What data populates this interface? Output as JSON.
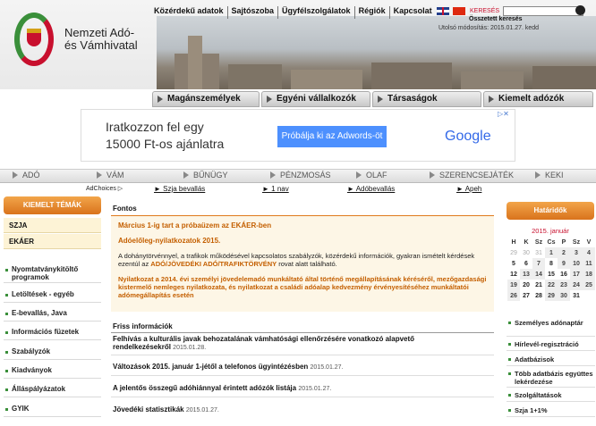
{
  "header": {
    "org_line1": "Nemzeti Adó-",
    "org_line2": "és Vámhivatal",
    "top_links": [
      "Közérdekű adatok",
      "Sajtószoba",
      "Ügyfélszolgálatok",
      "Régiók",
      "Kapcsolat"
    ],
    "search_label": "KERESÉS",
    "search_value": "",
    "advanced_search": "Összetett keresés",
    "last_modified": "Utolsó módosítás: 2015.01.27.  kedd",
    "lang_icons": [
      "uk-flag-icon",
      "china-flag-icon"
    ]
  },
  "main_tabs": [
    "Magánszemélyek",
    "Egyéni vállalkozók",
    "Társaságok",
    "Kiemelt adózók"
  ],
  "ad": {
    "line1": "Iratkozzon fel egy",
    "line2": "15000 Ft-os ajánlatra",
    "button": "Próbálja ki az Adwords-öt",
    "brand": "Google",
    "close": "▷✕"
  },
  "secondary_nav": [
    "ADÓ",
    "VÁM",
    "BŰNÜGY",
    "PÉNZMOSÁS",
    "OLAF",
    "SZERENCSEJÁTÉK",
    "KEKI"
  ],
  "adchoices": "AdChoices ▷",
  "quick_links": [
    "► Szja bevallás",
    "► 1 nav",
    "► Adóbevallás",
    "► Apeh"
  ],
  "featured": {
    "title": "KIEMELT TÉMÁK",
    "items": [
      "SZJA",
      "EKÁER"
    ]
  },
  "left_nav": [
    "Nyomtatványkitöltő programok",
    "Letöltések - egyéb",
    "E-bevallás, Java",
    "Információs füzetek",
    "Szabályzók",
    "Kiadványok",
    "Álláspályázatok",
    "GYIK"
  ],
  "important": {
    "title": "Fontos",
    "headline1": "Március 1-ig tart a próbaüzem az EKÁER-ben",
    "headline2": "Adóelőleg-nyilatkozatok 2015.",
    "text": "A dohánytörvénnyel, a trafikok működésével kapcsolatos szabályzók, közérdekű információk, gyakran ismételt kérdések ezentúl az",
    "text_link": "ADÓ/JÖVEDÉKI ADÓ/TRAFIKTÖRVÉNY",
    "text_end": " rovat alatt található.",
    "headline3": "Nyilatkozat a 2014. évi személyi jövedelemadó munkáltató által történő megállapításának kéréséről, mezőgazdasági kistermelő nemleges nyilatkozata, és nyilatkozat a családi adóalap kedvezmény érvényesítéséhez munkáltatói adómegállapítás esetén"
  },
  "fresh": {
    "title": "Friss információk",
    "items": [
      {
        "title": "Felhívás a kulturális javak behozatalának vámhatósági ellenőrzésére vonatkozó alapvető rendelkezésekről",
        "date": "2015.01.28."
      },
      {
        "title": "Változások 2015. január 1-jétől a telefonos ügyintézésben",
        "date": "2015.01.27."
      },
      {
        "title": "A jelentős összegű adóhiánnyal érintett adózók listája",
        "date": "2015.01.27."
      },
      {
        "title": "Jövedéki statisztikák",
        "date": "2015.01.27."
      }
    ]
  },
  "deadlines": {
    "title": "Határidők",
    "month": "2015. január",
    "weekdays": [
      "H",
      "K",
      "Sz",
      "Cs",
      "P",
      "Sz",
      "V"
    ],
    "weeks": [
      [
        "29",
        "30",
        "31",
        "1",
        "2",
        "3",
        "4"
      ],
      [
        "5",
        "6",
        "7",
        "8",
        "9",
        "10",
        "11"
      ],
      [
        "12",
        "13",
        "14",
        "15",
        "16",
        "17",
        "18"
      ],
      [
        "19",
        "20",
        "21",
        "22",
        "23",
        "24",
        "25"
      ],
      [
        "26",
        "27",
        "28",
        "29",
        "30",
        "31",
        ""
      ]
    ]
  },
  "right_nav": [
    "Személyes adónaptár",
    "Hírlevél-regisztráció",
    "Adatbázisok",
    "Több adatbázis együttes lekérdezése",
    "Szolgáltatások",
    "Szja 1+1%"
  ],
  "colors": {
    "accent_orange": "#d9731c",
    "link_red": "#c45f00",
    "brand_green": "#3a8f3a",
    "brand_red": "#c8102e"
  }
}
